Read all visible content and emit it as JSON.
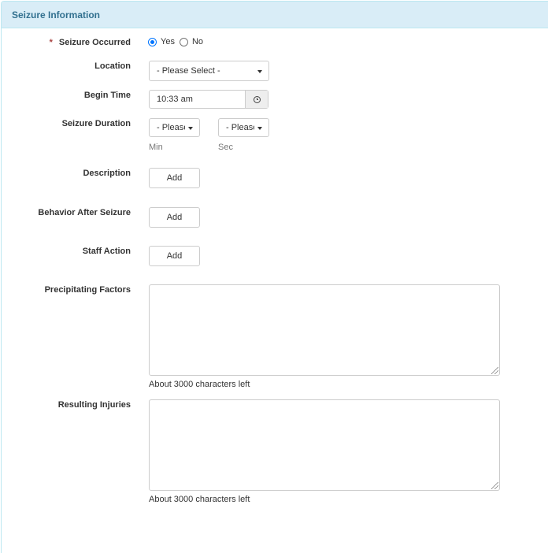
{
  "panel": {
    "title": "Seizure Information"
  },
  "fields": {
    "seizure_occurred": {
      "label": "Seizure Occurred",
      "required_marker": "*",
      "options": [
        {
          "label": "Yes",
          "checked": true
        },
        {
          "label": "No",
          "checked": false
        }
      ]
    },
    "location": {
      "label": "Location",
      "value": "- Please Select -"
    },
    "begin_time": {
      "label": "Begin Time",
      "value": "10:33 am",
      "addon_icon": "clock-icon"
    },
    "seizure_duration": {
      "label": "Seizure Duration",
      "min": {
        "value": "- Please Select -",
        "hint": "Min"
      },
      "sec": {
        "value": "- Please Select -",
        "hint": "Sec"
      }
    },
    "description": {
      "label": "Description",
      "button": "Add"
    },
    "behavior_after_seizure": {
      "label": "Behavior After Seizure",
      "button": "Add"
    },
    "staff_action": {
      "label": "Staff Action",
      "button": "Add"
    },
    "precipitating_factors": {
      "label": "Precipitating Factors",
      "value": "",
      "chars_left": "About 3000 characters left"
    },
    "resulting_injuries": {
      "label": "Resulting Injuries",
      "value": "",
      "chars_left": "About 3000 characters left"
    }
  }
}
